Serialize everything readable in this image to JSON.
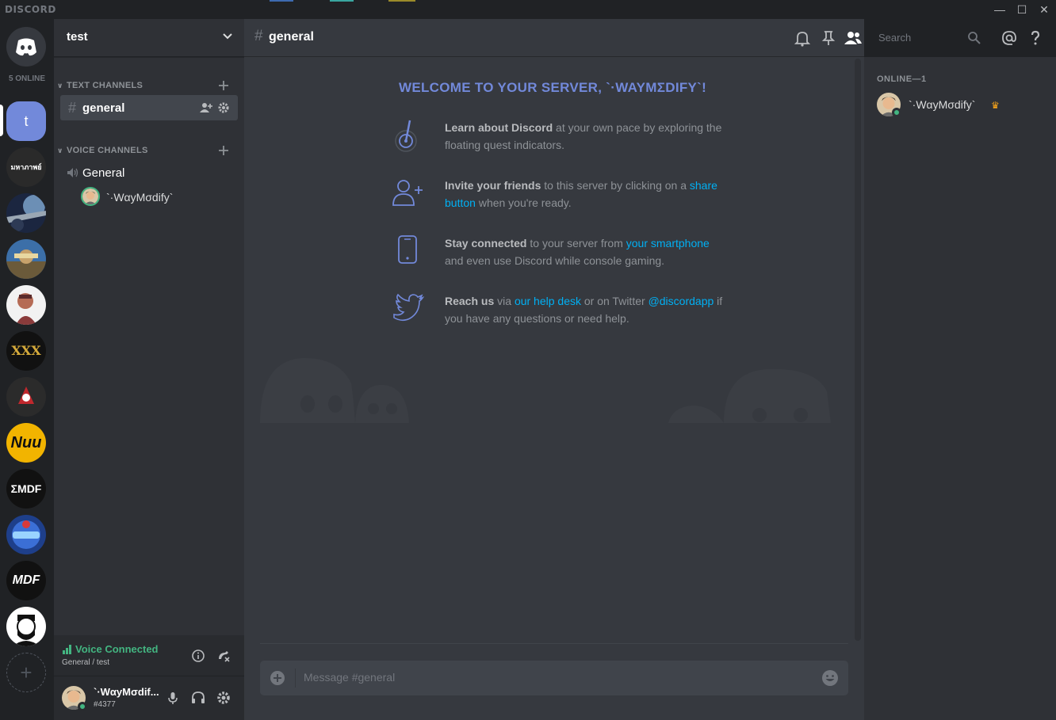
{
  "window": {
    "brand": "DISCORD",
    "minimize": "—",
    "maximize": "☐",
    "close": "✕"
  },
  "guilds": {
    "online_count": "5 ONLINE",
    "selected_initial": "t",
    "thai_server_label": "มหาภาพย์",
    "nuu_label": "Nuu",
    "emdf_label": "ƩMDF",
    "mdf_label": "MDF",
    "add_server": "+"
  },
  "sidebar": {
    "server_name": "test",
    "text_category": "TEXT CHANNELS",
    "voice_category": "VOICE CHANNELS",
    "text_channels": [
      {
        "hash": "#",
        "name": "general"
      }
    ],
    "voice_channels": [
      {
        "name": "General"
      }
    ],
    "voice_users": [
      {
        "name": "`·WαyMσdify`"
      }
    ]
  },
  "voice_panel": {
    "status": "Voice Connected",
    "subtitle": "General / test"
  },
  "user_panel": {
    "username": "`·WαyMσdif...",
    "tag": "#4377"
  },
  "chat": {
    "hash": "#",
    "channel_name": "general",
    "search_placeholder": "Search",
    "welcome_title": "WELCOME TO YOUR SERVER, `·WAYMƩDIFY`!",
    "tips": [
      {
        "bold": "Learn about Discord",
        "text1": " at your own pace by exploring the floating quest indicators.",
        "link": "",
        "text2": ""
      },
      {
        "bold": "Invite your friends",
        "text1": " to this server by clicking on a ",
        "link": "share button",
        "text2": " when you're ready."
      },
      {
        "bold": "Stay connected",
        "text1": " to your server from ",
        "link": "your smartphone",
        "text2": " and even use Discord while console gaming."
      },
      {
        "bold": "Reach us",
        "text1": " via ",
        "link": "our help desk",
        "text2": " or on Twitter ",
        "link2": "@discordapp",
        "text3": " if you have any questions or need help."
      }
    ],
    "composer_placeholder": "Message #general"
  },
  "members": {
    "title": "ONLINE—1",
    "list": [
      {
        "name": "`·WαyMσdify`",
        "crown": "♛"
      }
    ]
  },
  "colors": {
    "blurple": "#7289da",
    "online": "#43b581",
    "link": "#00b0f4",
    "crown": "#faa61a"
  }
}
